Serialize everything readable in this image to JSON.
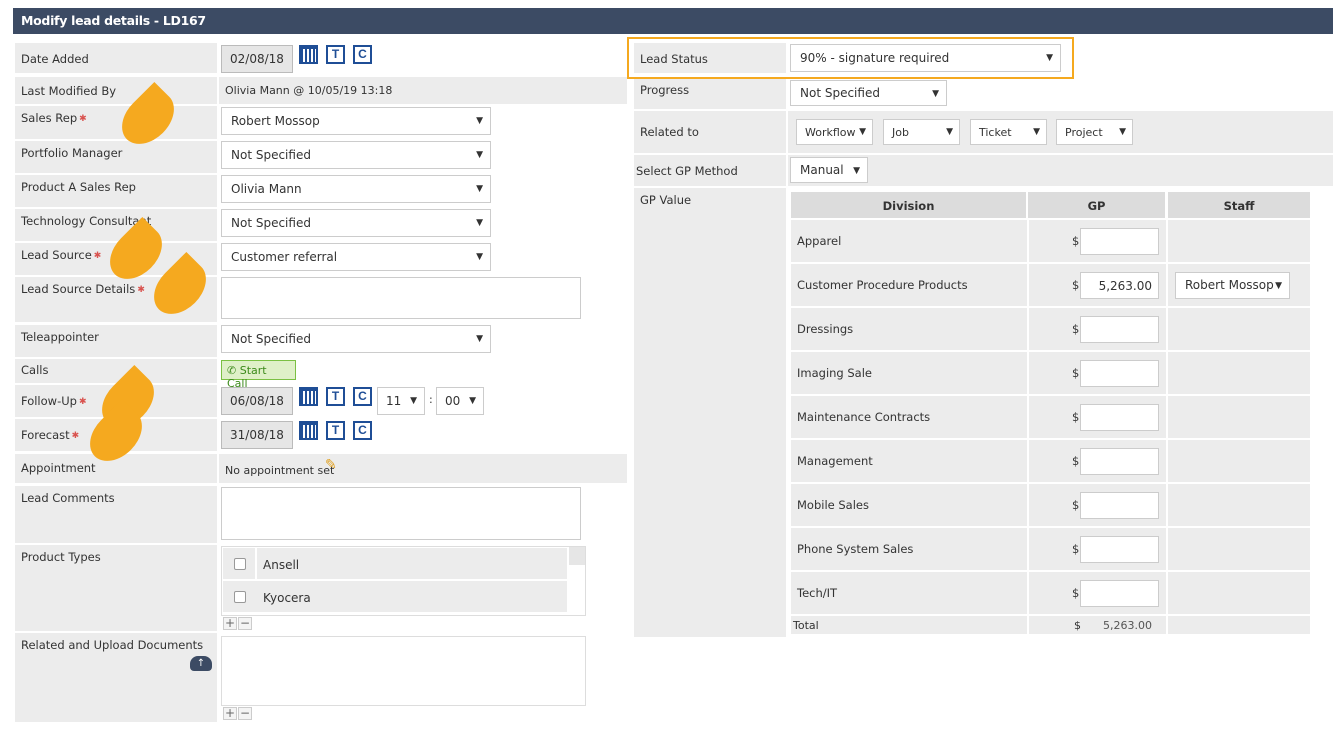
{
  "header": {
    "title": "Modify lead details - LD167"
  },
  "left": {
    "date_added": {
      "label": "Date Added",
      "value": "02/08/18"
    },
    "last_modified": {
      "label": "Last Modified By",
      "value": "Olivia Mann @ 10/05/19 13:18"
    },
    "sales_rep": {
      "label": "Sales Rep",
      "value": "Robert Mossop"
    },
    "portfolio_manager": {
      "label": "Portfolio Manager",
      "value": "Not Specified"
    },
    "product_a_sales_rep": {
      "label": "Product A Sales Rep",
      "value": "Olivia Mann"
    },
    "technology_consultant": {
      "label": "Technology Consultant",
      "value": "Not Specified"
    },
    "lead_source": {
      "label": "Lead Source",
      "value": "Customer referral"
    },
    "lead_source_details": {
      "label": "Lead Source Details",
      "value": ""
    },
    "teleappointer": {
      "label": "Teleappointer",
      "value": "Not Specified"
    },
    "calls": {
      "label": "Calls",
      "button": "Start Call"
    },
    "follow_up": {
      "label": "Follow-Up",
      "date": "06/08/18",
      "hour": "11",
      "minute": "00"
    },
    "forecast": {
      "label": "Forecast",
      "date": "31/08/18"
    },
    "appointment": {
      "label": "Appointment",
      "value": "No appointment set"
    },
    "lead_comments": {
      "label": "Lead Comments",
      "value": ""
    },
    "product_types": {
      "label": "Product Types",
      "items": [
        "Ansell",
        "Kyocera"
      ]
    },
    "related_docs": {
      "label": "Related and Upload Documents"
    }
  },
  "icons": {
    "t": "T",
    "c": "C",
    "plus": "+",
    "minus": "−",
    "required": "✱",
    "time_sep": ":"
  },
  "right": {
    "lead_status": {
      "label": "Lead Status",
      "value": "90% - signature required"
    },
    "progress": {
      "label": "Progress",
      "value": "Not Specified"
    },
    "related_to": {
      "label": "Related to",
      "items": [
        "Workflow",
        "Job",
        "Ticket",
        "Project"
      ]
    },
    "gp_method": {
      "label": "Select GP Method",
      "value": "Manual"
    },
    "gp_value": {
      "label": "GP Value"
    },
    "table": {
      "headers": [
        "Division",
        "GP",
        "Staff"
      ],
      "currency": "$",
      "rows": [
        {
          "division": "Apparel",
          "gp": "",
          "staff": ""
        },
        {
          "division": "Customer Procedure Products",
          "gp": "5,263.00",
          "staff": "Robert Mossop"
        },
        {
          "division": "Dressings",
          "gp": "",
          "staff": ""
        },
        {
          "division": "Imaging Sale",
          "gp": "",
          "staff": ""
        },
        {
          "division": "Maintenance Contracts",
          "gp": "",
          "staff": ""
        },
        {
          "division": "Management",
          "gp": "",
          "staff": ""
        },
        {
          "division": "Mobile Sales",
          "gp": "",
          "staff": ""
        },
        {
          "division": "Phone System Sales",
          "gp": "",
          "staff": ""
        },
        {
          "division": "Tech/IT",
          "gp": "",
          "staff": ""
        }
      ],
      "total": {
        "label": "Total",
        "value": "5,263.00"
      }
    }
  },
  "colors": {
    "header_bg": "#3c4b64",
    "highlight": "#f5a91f",
    "row_bg": "#ececec",
    "required": "#d9534f",
    "icon_blue": "#1f4e96"
  }
}
